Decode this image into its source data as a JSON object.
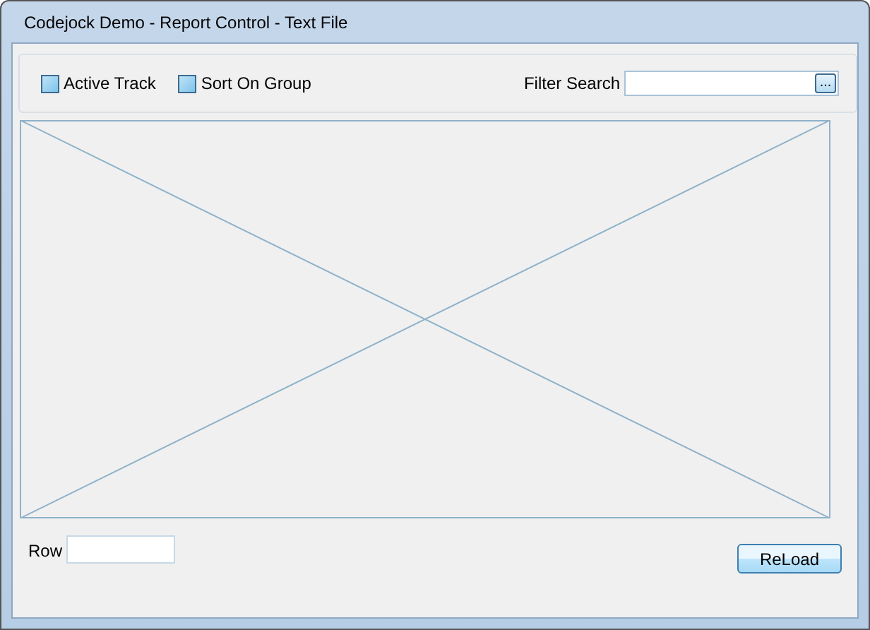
{
  "window": {
    "title": "Codejock Demo - Report Control - Text File"
  },
  "options": [
    {
      "label": "Active Track",
      "checked": false
    },
    {
      "label": "Sort On Group",
      "checked": false
    }
  ],
  "filter": {
    "label": "Filter Search",
    "browse_button": "..."
  },
  "row": {
    "label": "Row"
  },
  "buttons": [
    "ReLoad"
  ]
}
